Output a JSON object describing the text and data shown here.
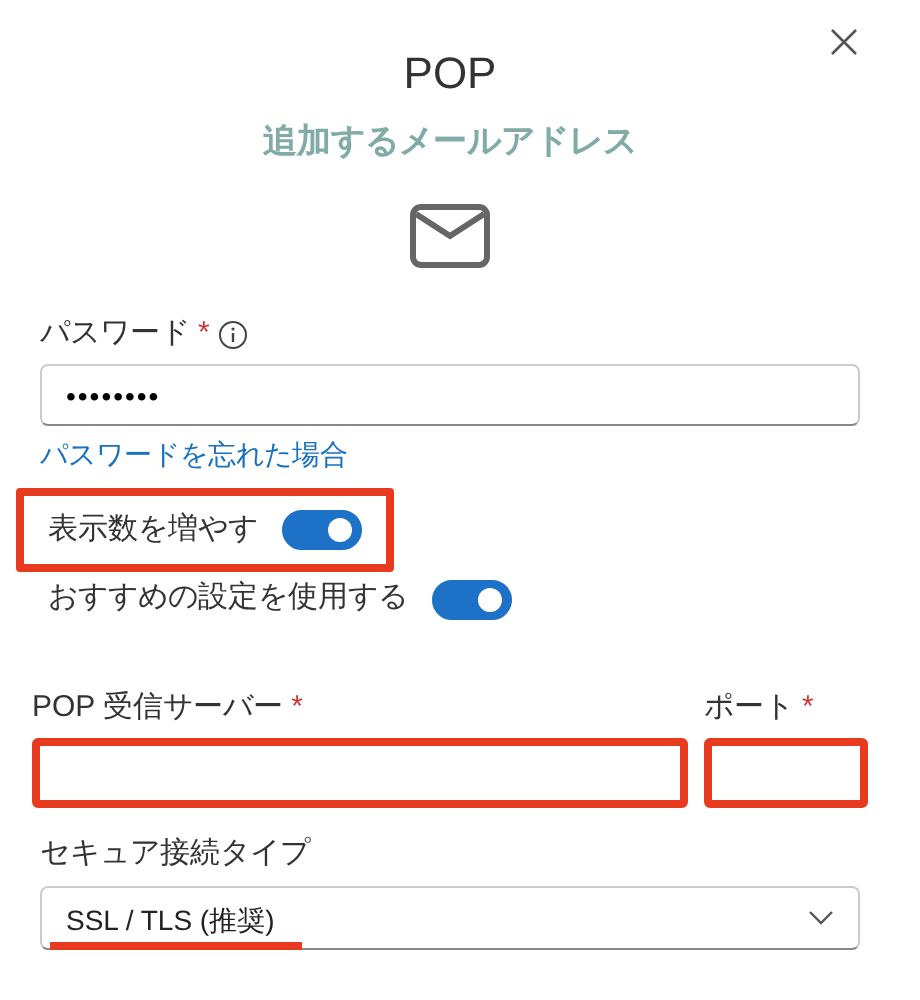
{
  "title": "POP",
  "subtitle": "追加するメールアドレス",
  "password": {
    "label": "パスワード",
    "required_mark": "*",
    "value": "••••••••"
  },
  "forgot_link": "パスワードを忘れた場合",
  "toggles": [
    {
      "label": "表示数を増やす",
      "on": true,
      "highlighted": true
    },
    {
      "label": "おすすめの設定を使用する",
      "on": true,
      "highlighted": false
    }
  ],
  "server": {
    "label": "POP 受信サーバー",
    "required_mark": "*",
    "highlighted": true
  },
  "port": {
    "label": "ポート",
    "required_mark": "*",
    "highlighted": true
  },
  "security": {
    "label": "セキュア接続タイプ",
    "value": "SSL / TLS (推奨)",
    "underlined": true
  }
}
